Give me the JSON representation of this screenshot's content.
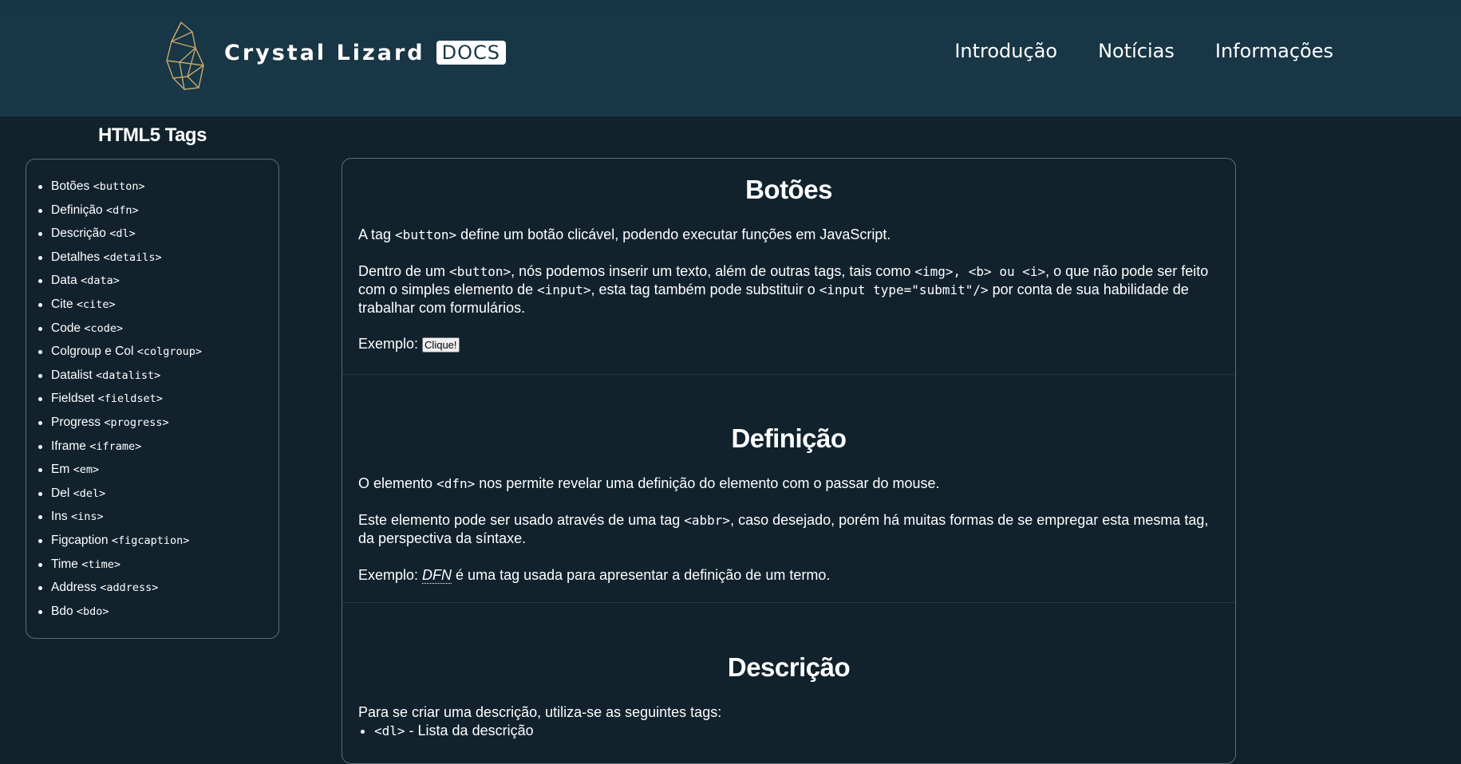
{
  "header": {
    "brand_name": "Crystal Lizard",
    "brand_badge": "DOCS",
    "nav": [
      "Introdução",
      "Notícias",
      "Informações"
    ]
  },
  "sidebar": {
    "title": "HTML5 Tags",
    "items": [
      {
        "label": "Botões",
        "tag": "<button>"
      },
      {
        "label": "Definição",
        "tag": "<dfn>"
      },
      {
        "label": "Descrição",
        "tag": "<dl>"
      },
      {
        "label": "Detalhes",
        "tag": "<details>"
      },
      {
        "label": "Data",
        "tag": "<data>"
      },
      {
        "label": "Cite",
        "tag": "<cite>"
      },
      {
        "label": "Code",
        "tag": "<code>"
      },
      {
        "label": "Colgroup e Col",
        "tag": "<colgroup>"
      },
      {
        "label": "Datalist",
        "tag": "<datalist>"
      },
      {
        "label": "Fieldset",
        "tag": "<fieldset>"
      },
      {
        "label": "Progress",
        "tag": "<progress>"
      },
      {
        "label": "Iframe",
        "tag": "<iframe>"
      },
      {
        "label": "Em",
        "tag": "<em>"
      },
      {
        "label": "Del",
        "tag": "<del>"
      },
      {
        "label": "Ins",
        "tag": "<ins>"
      },
      {
        "label": "Figcaption",
        "tag": "<figcaption>"
      },
      {
        "label": "Time",
        "tag": "<time>"
      },
      {
        "label": "Address",
        "tag": "<address>"
      },
      {
        "label": "Bdo",
        "tag": "<bdo>"
      }
    ]
  },
  "sections": {
    "buttons": {
      "title": "Botões",
      "p1_a": "A tag ",
      "p1_code": "<button>",
      "p1_b": " define um botão clicável, podendo executar funções em JavaScript.",
      "p2_a": "Dentro de um ",
      "p2_code1": "<button>",
      "p2_b": ", nós podemos inserir um texto, além de outras tags, tais como ",
      "p2_code2": "<img>, <b> ou <i>",
      "p2_c": ", o que não pode ser feito com o simples elemento de ",
      "p2_code3": "<input>",
      "p2_d": ", esta tag também pode substituir o ",
      "p2_code4": "<input type=\"submit\"/>",
      "p2_e": " por conta de sua habilidade de trabalhar com formulários.",
      "example_label": "Exemplo: ",
      "example_button": "Clique!"
    },
    "definition": {
      "title": "Definição",
      "p1_a": "O elemento ",
      "p1_code": "<dfn>",
      "p1_b": " nos permite revelar uma definição do elemento com o passar do mouse.",
      "p2_a": "Este elemento pode ser usado através de uma tag ",
      "p2_code": "<abbr>",
      "p2_b": ", caso desejado, porém há muitas formas de se empregar esta mesma tag, da perspectiva da síntaxe.",
      "example_label": "Exemplo: ",
      "example_term": "DFN",
      "example_rest": " é uma tag usada para apresentar a definição de um termo."
    },
    "description": {
      "title": "Descrição",
      "p1": "Para se criar uma descrição, utiliza-se as seguintes tags:",
      "li1_code": "<dl>",
      "li1_text": " - Lista da descrição"
    }
  }
}
